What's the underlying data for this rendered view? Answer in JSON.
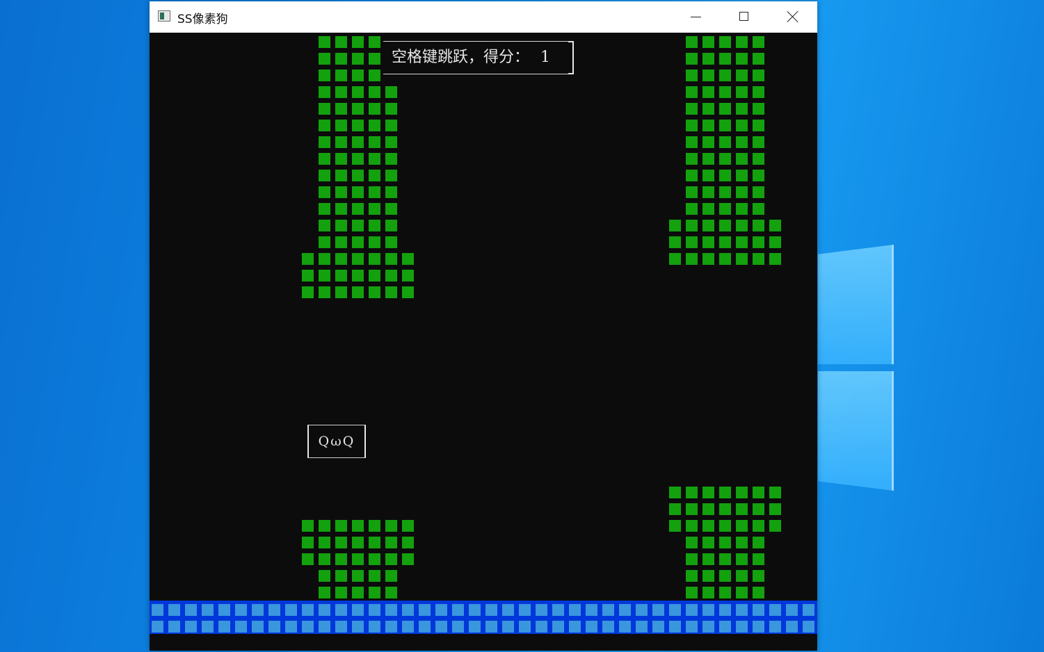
{
  "window": {
    "title": "SS像素狗",
    "icon": "console-app-icon",
    "controls": [
      "minimize-icon",
      "maximize-icon",
      "close-icon"
    ]
  },
  "hud": {
    "instruction_label": "空格键跳跃，得分：",
    "score": "1"
  },
  "player": {
    "face": "QωQ"
  },
  "colors": {
    "background": "#0c0c0c",
    "pipe": "#13a10e",
    "ground_base": "#0037da",
    "ground_tile": "#3a96dd",
    "text": "#e6e6e6"
  }
}
